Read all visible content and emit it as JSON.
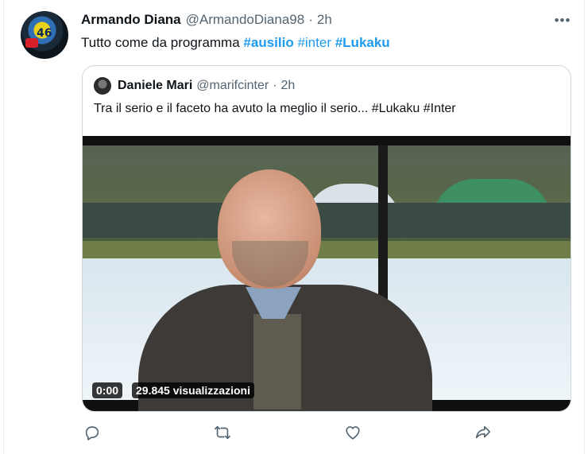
{
  "tweet": {
    "author_name": "Armando Diana",
    "author_handle": "@ArmandoDiana98",
    "separator": "·",
    "time": "2h",
    "more_icon": "more-icon",
    "text_prefix": "Tutto come da programma ",
    "hashtags": [
      "#ausilio",
      "#inter",
      "#Lukaku"
    ]
  },
  "quoted": {
    "author_name": "Daniele Mari",
    "author_handle": "@marifcinter",
    "separator": "·",
    "time": "2h",
    "text": "Tra il serio e il faceto ha avuto la meglio il serio... #Lukaku #Inter",
    "video": {
      "elapsed": "0:00",
      "views": "29.845 visualizzazioni"
    }
  },
  "actions": {
    "reply_icon": "reply-icon",
    "retweet_icon": "retweet-icon",
    "like_icon": "like-icon",
    "share_icon": "share-icon"
  },
  "colors": {
    "link": "#1d9bf0",
    "secondary_text": "#536471",
    "border": "#cfd9de"
  }
}
